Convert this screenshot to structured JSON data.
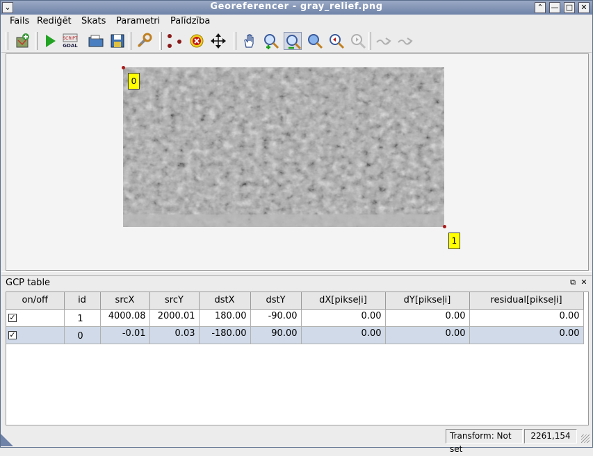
{
  "window": {
    "title": "Georeferencer - gray_relief.png"
  },
  "menu": [
    "Fails",
    "Rediģēt",
    "Skats",
    "Parametri",
    "Palīdzība"
  ],
  "toolbar": {
    "tools": [
      "open-raster-icon",
      "start-georeferencing-icon",
      "generate-gdal-script-icon",
      "load-gcp-icon",
      "save-gcp-icon",
      "transformation-settings-icon",
      "add-point-icon",
      "delete-point-icon",
      "move-gcp-icon",
      "pan-icon",
      "zoom-in-icon",
      "zoom-out-icon",
      "zoom-to-layer-icon",
      "zoom-last-icon",
      "zoom-next-icon",
      "link-georeferencer-icon",
      "link-qgis-icon"
    ]
  },
  "canvas": {
    "gcp_labels": [
      "0",
      "1"
    ]
  },
  "dock": {
    "title": "GCP table"
  },
  "gcp_table": {
    "columns": [
      "on/off",
      "id",
      "srcX",
      "srcY",
      "dstX",
      "dstY",
      "dX[pikseļi]",
      "dY[pikseļi]",
      "residual[pikseļi]"
    ],
    "rows": [
      {
        "checked": true,
        "id": "1",
        "srcX": "4000.08",
        "srcY": "2000.01",
        "dstX": "180.00",
        "dstY": "-90.00",
        "dX": "0.00",
        "dY": "0.00",
        "residual": "0.00"
      },
      {
        "checked": true,
        "id": "0",
        "srcX": "-0.01",
        "srcY": "0.03",
        "dstX": "-180.00",
        "dstY": "90.00",
        "dX": "0.00",
        "dY": "0.00",
        "residual": "0.00"
      }
    ]
  },
  "status": {
    "transform": "Transform: Not set",
    "coords": "2261,154"
  },
  "colors": {
    "titlebar": "#6f83a9",
    "selected_row": "#d0dae8",
    "gcp_label": "#ffff00",
    "gcp_dot": "#aa1a1a"
  }
}
